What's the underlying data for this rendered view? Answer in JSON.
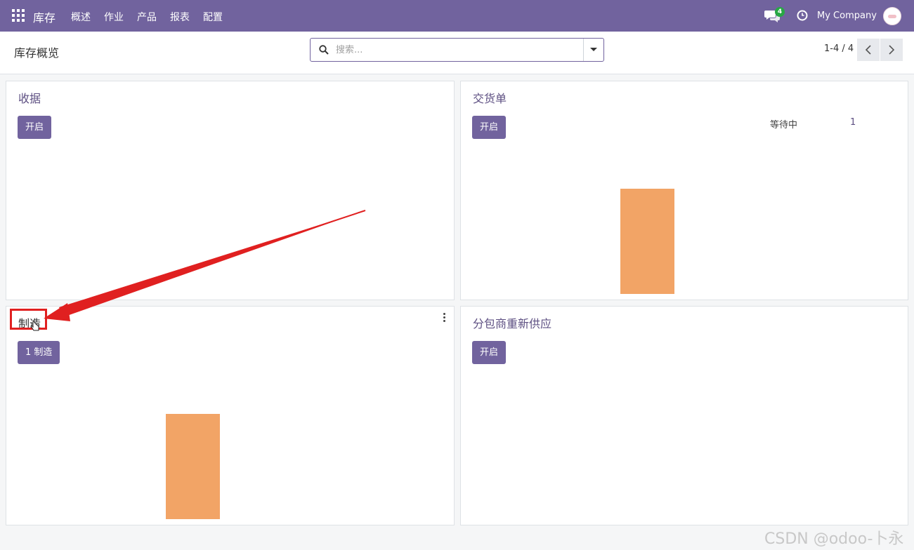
{
  "navbar": {
    "app_title": "库存",
    "menu": [
      "概述",
      "作业",
      "产品",
      "报表",
      "配置"
    ],
    "chat_badge": "4",
    "company": "My Company",
    "icons": [
      "apps-grid-icon",
      "chat-icon",
      "clock-icon",
      "avatar"
    ]
  },
  "control_panel": {
    "breadcrumb": "库存概览",
    "search_placeholder": "搜索...",
    "pager": "1-4 / 4"
  },
  "cards": [
    {
      "title": "收据",
      "button": "开启"
    },
    {
      "title": "交货单",
      "button": "开启",
      "stat_label": "等待中",
      "stat_value": "1"
    },
    {
      "title": "制造",
      "button": "1 制造"
    },
    {
      "title": "分包商重新供应",
      "button": "开启"
    }
  ],
  "colors": {
    "brand": "#71639e",
    "bar": "#f2a466",
    "annotation": "#e02020"
  },
  "watermark": "CSDN @odoo-卜永"
}
